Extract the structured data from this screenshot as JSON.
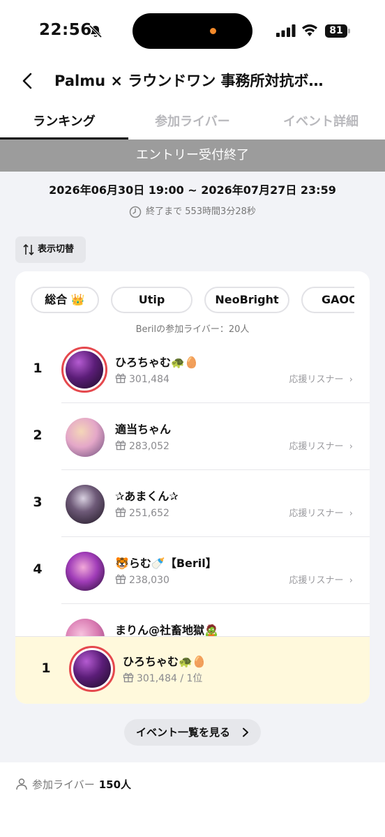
{
  "status_bar": {
    "time": "22:56",
    "battery": "81"
  },
  "header": {
    "title": "Palmu × ラウンドワン 事務所対抗ボ…"
  },
  "tabs": [
    {
      "label": "ランキング",
      "active": true
    },
    {
      "label": "参加ライバー",
      "active": false
    },
    {
      "label": "イベント詳細",
      "active": false
    }
  ],
  "event": {
    "banner": "エントリー受付終了",
    "period": "2026年06月30日 19:00 ~ 2026年07月27日 23:59",
    "remaining": "終了まで 553時間3分28秒"
  },
  "switch_label": "表示切替",
  "filter_chips": [
    "総合 👑",
    "Utip",
    "NeoBright",
    "GAOO"
  ],
  "participants_note": "Berilの参加ライバー：20人",
  "supporter_label": "応援リスナー",
  "ranking": [
    {
      "rank": "1",
      "name": "ひろちゃむ🐢🥚",
      "points": "301,484"
    },
    {
      "rank": "2",
      "name": "適当ちゃん",
      "points": "283,052"
    },
    {
      "rank": "3",
      "name": "✰あまくん✰",
      "points": "251,652"
    },
    {
      "rank": "4",
      "name": "🐯らむ🍼【Beril】",
      "points": "238,030"
    },
    {
      "rank": "",
      "name": "まりん@社畜地獄🧟",
      "points": ""
    }
  ],
  "my_entry": {
    "rank": "1",
    "name": "ひろちゃむ🐢🥚",
    "points": "301,484 / 1位"
  },
  "event_list_button": "イベント一覧を見る",
  "footer": {
    "label": "参加ライバー",
    "count": "150人"
  },
  "colors": {
    "accent_ring": "#e5484d",
    "highlight_bg": "#fff9dc",
    "banner_bg": "#9c9c9c"
  }
}
